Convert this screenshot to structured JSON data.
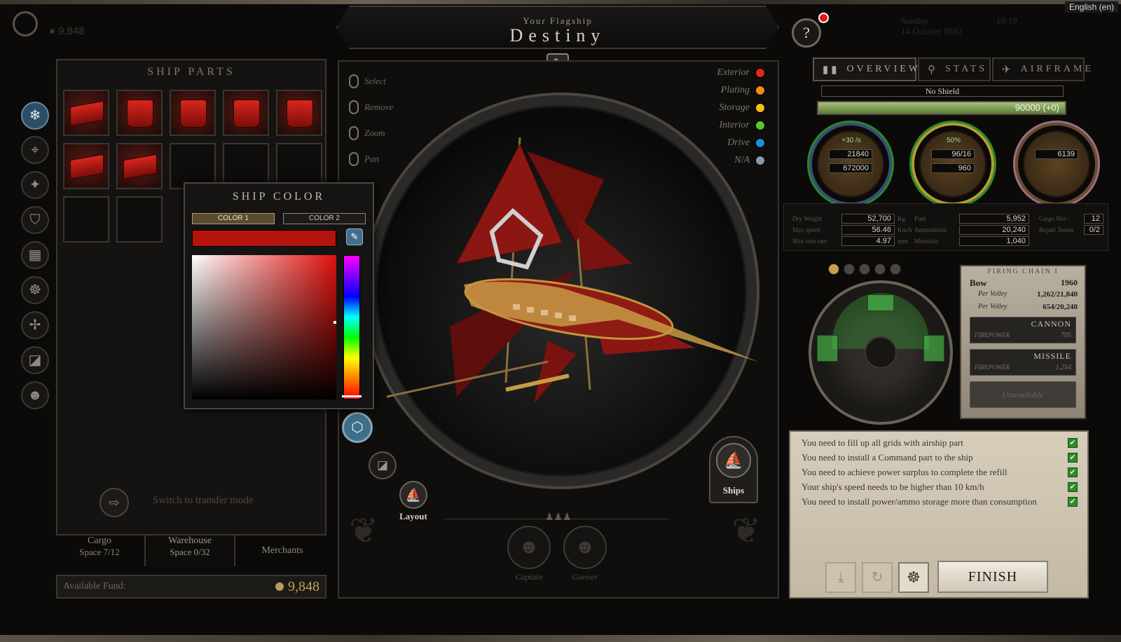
{
  "top": {
    "language": "English (en)",
    "fund_top": "9,848",
    "date_day": "Sunday",
    "date_full": "14 October 0592",
    "time": "10:10"
  },
  "flagship": {
    "subtitle": "Your Flagship",
    "name": "Destiny"
  },
  "ship_parts": {
    "title": "SHIP PARTS",
    "slots_filled": 7,
    "slots_total": 12
  },
  "ship_color": {
    "title": "SHIP COLOR",
    "tab1": "COLOR 1",
    "tab2": "COLOR 2",
    "current_color": "#b4130e"
  },
  "bottom_left": {
    "switch_text": "Switch to transfer mode",
    "tabs": [
      {
        "label": "Cargo",
        "sub": "Space 7/12"
      },
      {
        "label": "Warehouse",
        "sub": "Space 0/32"
      },
      {
        "label": "Merchants",
        "sub": ""
      }
    ],
    "fund_label": "Available Fund:",
    "fund_value": "9,848"
  },
  "controls": [
    "Select",
    "Remove",
    "Zoom",
    "Pan"
  ],
  "legend": [
    {
      "label": "Exterior",
      "color": "#e02a1f"
    },
    {
      "label": "Plating",
      "color": "#f08c17"
    },
    {
      "label": "Storage",
      "color": "#f0c317"
    },
    {
      "label": "Interior",
      "color": "#55c92a"
    },
    {
      "label": "Drive",
      "color": "#1e8fd9"
    },
    {
      "label": "N/A",
      "color": "#8a9aa3"
    }
  ],
  "viewport": {
    "layout_label": "Layout",
    "ships_label": "Ships",
    "crew": [
      {
        "role": "Captain"
      },
      {
        "role": "Gunner"
      }
    ]
  },
  "right_tabs": {
    "overview": "OVERVIEW",
    "stats": "STATS",
    "airframe": "AIRFRAME"
  },
  "shield": {
    "label": "No Shield",
    "value": "90000 (+0)"
  },
  "gauges": [
    {
      "top": "+30 /s",
      "v1": "21840",
      "v2": "672000"
    },
    {
      "top": "50%",
      "v1": "96/16",
      "v2": "960"
    },
    {
      "top": "",
      "v1": "6139",
      "v2": ""
    }
  ],
  "stats": {
    "col1": [
      {
        "label": "Dry Weight",
        "value": "52,700",
        "unit": "Kg"
      },
      {
        "label": "Max speed",
        "value": "56.46",
        "unit": "Km/h"
      },
      {
        "label": "Max turn rate",
        "value": "4.97",
        "unit": "rpm"
      }
    ],
    "col2": [
      {
        "label": "Fuel",
        "value": "5,952"
      },
      {
        "label": "Ammunition",
        "value": "20,240"
      },
      {
        "label": "Materials",
        "value": "1,040"
      }
    ],
    "col3": [
      {
        "label": "Cargo Slot :",
        "value": "12"
      },
      {
        "label": "Repair Teams",
        "value": "0/2"
      }
    ]
  },
  "firing": {
    "title": "FIRING CHAIN I",
    "bow": "Bow",
    "bow_value": "1960",
    "per_volley1_label": "Per Volley",
    "per_volley1": "1,262/21,840",
    "per_volley2_label": "Per Volley",
    "per_volley2": "654/20,240",
    "weapons": [
      {
        "name": "CANNON",
        "firepower_label": "FIREPOWER",
        "firepower": "705"
      },
      {
        "name": "MISSILE",
        "firepower_label": "FIREPOWER",
        "firepower": "1,254"
      }
    ],
    "unavailable": "Unavailable"
  },
  "requirements": [
    "You need to fill up all grids with airship part",
    "You need to install a Command part to the ship",
    "You need to achieve power surplus to complete the refill",
    "Your ship's speed needs to be higher than 10 km/h",
    "You need to install power/ammo storage more than consumption"
  ],
  "finish_label": "FINISH"
}
